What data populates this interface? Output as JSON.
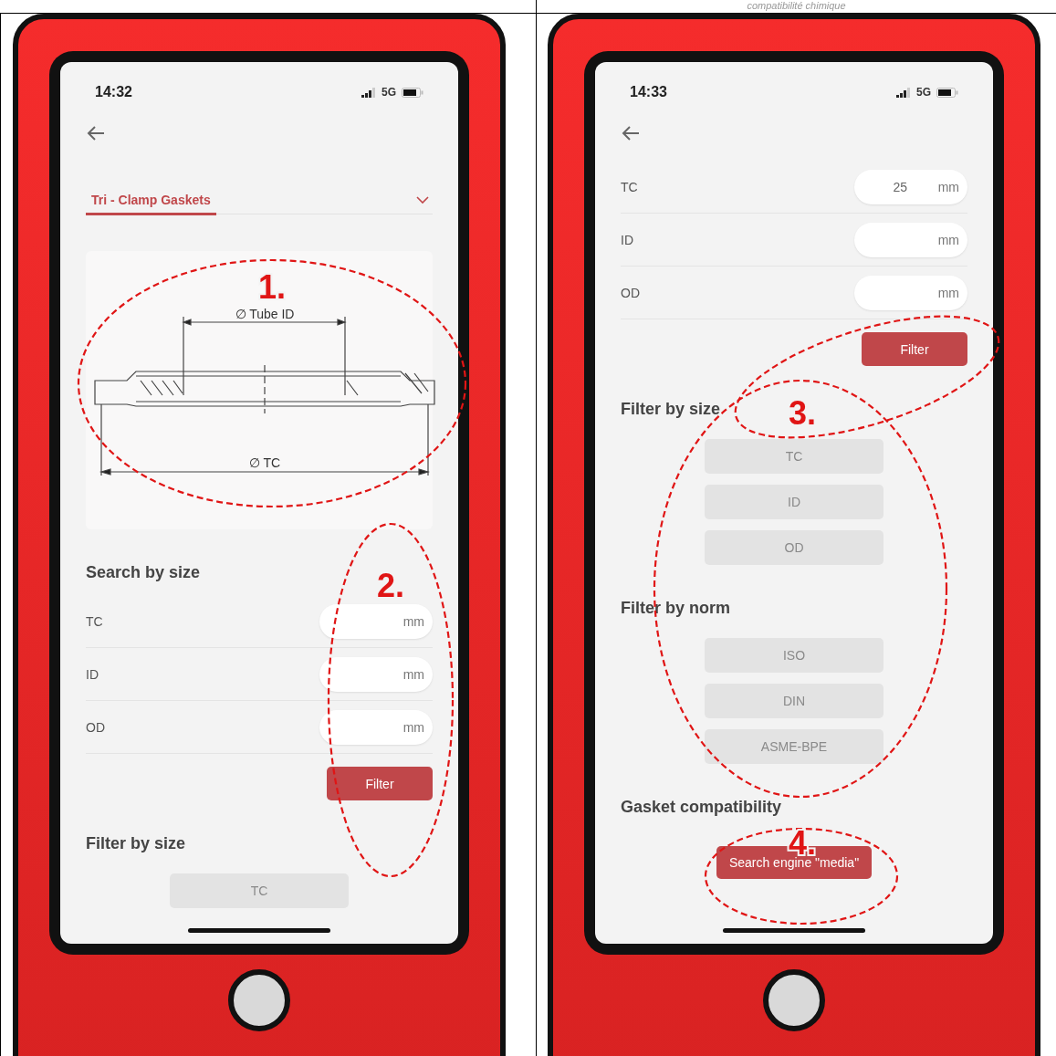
{
  "header": {
    "caption": "compatibilité chimique"
  },
  "phones": [
    {
      "status": {
        "time": "14:32",
        "network": "5G"
      },
      "sections": [
        {
          "kind": "dropdown",
          "label": "Tri - Clamp Gaskets"
        },
        {
          "kind": "diagram",
          "labels": [
            "∅ Tube ID",
            "∅ TC"
          ]
        },
        {
          "kind": "heading",
          "text": "Search by size"
        },
        {
          "kind": "size-field",
          "label": "TC",
          "unit": "mm"
        },
        {
          "kind": "size-field",
          "label": "ID",
          "unit": "mm"
        },
        {
          "kind": "size-field",
          "label": "OD",
          "unit": "mm"
        },
        {
          "kind": "primary-button",
          "text": "Filter"
        },
        {
          "kind": "heading",
          "text": "Filter by size"
        },
        {
          "kind": "chips",
          "items": [
            "TC"
          ]
        }
      ]
    },
    {
      "status": {
        "time": "14:33",
        "network": "5G"
      },
      "sections": [
        {
          "kind": "size-field",
          "label": "TC",
          "value": "25",
          "unit": "mm"
        },
        {
          "kind": "size-field",
          "label": "ID",
          "unit": "mm"
        },
        {
          "kind": "size-field",
          "label": "OD",
          "unit": "mm"
        },
        {
          "kind": "primary-button",
          "text": "Filter"
        },
        {
          "kind": "heading",
          "text": "Filter by size"
        },
        {
          "kind": "chips",
          "items": [
            "TC",
            "ID",
            "OD"
          ]
        },
        {
          "kind": "heading",
          "text": "Filter by norm"
        },
        {
          "kind": "chips",
          "items": [
            "ISO",
            "DIN",
            "ASME-BPE"
          ]
        },
        {
          "kind": "heading",
          "text": "Gasket compatibility"
        },
        {
          "kind": "center-button",
          "text": "Search engine \"media\""
        }
      ]
    }
  ],
  "annotations": [
    {
      "number": "1."
    },
    {
      "number": "2."
    },
    {
      "number": "3."
    },
    {
      "number": "4."
    }
  ]
}
